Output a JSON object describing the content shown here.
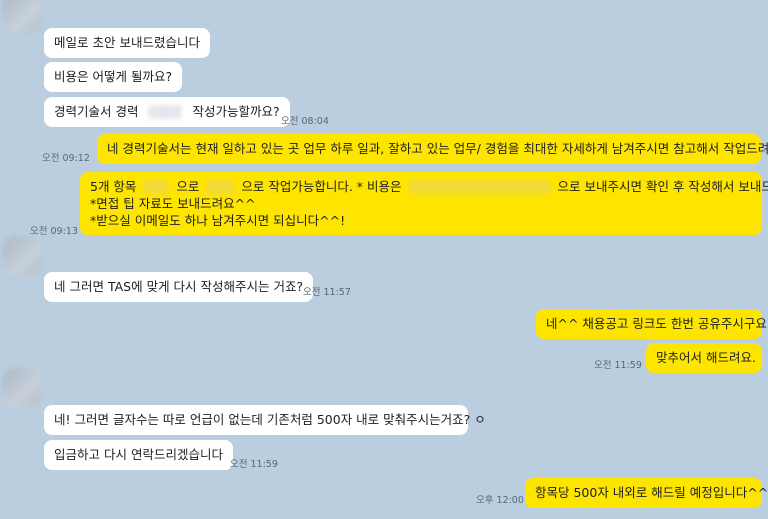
{
  "messages": {
    "m1": "메일로 초안 보내드렸습니다",
    "m2": "비용은 어떻게 될까요?",
    "m3a": "경력기술서 경력",
    "m3b": "작성가능할까요?",
    "t3": "오전 08:04",
    "m4": "네 경력기술서는 현재 일하고 있는 곳 업무 하루 일과, 잘하고 있는 업무/ 경험을 최대한 자세하게 남겨주시면 참고해서 작업드려요!",
    "t4": "오전 09:12",
    "m5_l1_a": "5개 항목",
    "m5_l1_b": "으로",
    "m5_l1_c": "으로 작업가능합니다. * 비용은",
    "m5_l1_d": "으로 보내주시면 확인 후 작성해서 보내드려요.",
    "m5_l2": "*면접 팁 자료도 보내드려요^^",
    "m5_l3": "*받으실 이메일도 하나 남겨주시면 되십니다^^!",
    "t5": "오전 09:13",
    "m6": "네 그러면 TAS에 맞게 다시 작성해주시는 거죠?",
    "t6": "오전 11:57",
    "m7": "네^^ 채용공고 링크도 한번 공유주시구요",
    "m8": "맞추어서 해드려요.",
    "t8": "오전 11:59",
    "m9": "네! 그러면 글자수는 따로 언급이 없는데 기존처럼 500자 내로 맞춰주시는거죠? ㅇ",
    "m10": "입금하고 다시 연락드리겠습니다",
    "t10": "오전 11:59",
    "m11": "항목당 500자 내외로 해드릴 예정입니다^^",
    "t11": "오후 12:00"
  },
  "colors": {
    "background": "#bacee0",
    "incoming_bubble": "#ffffff",
    "outgoing_bubble": "#fee500"
  }
}
